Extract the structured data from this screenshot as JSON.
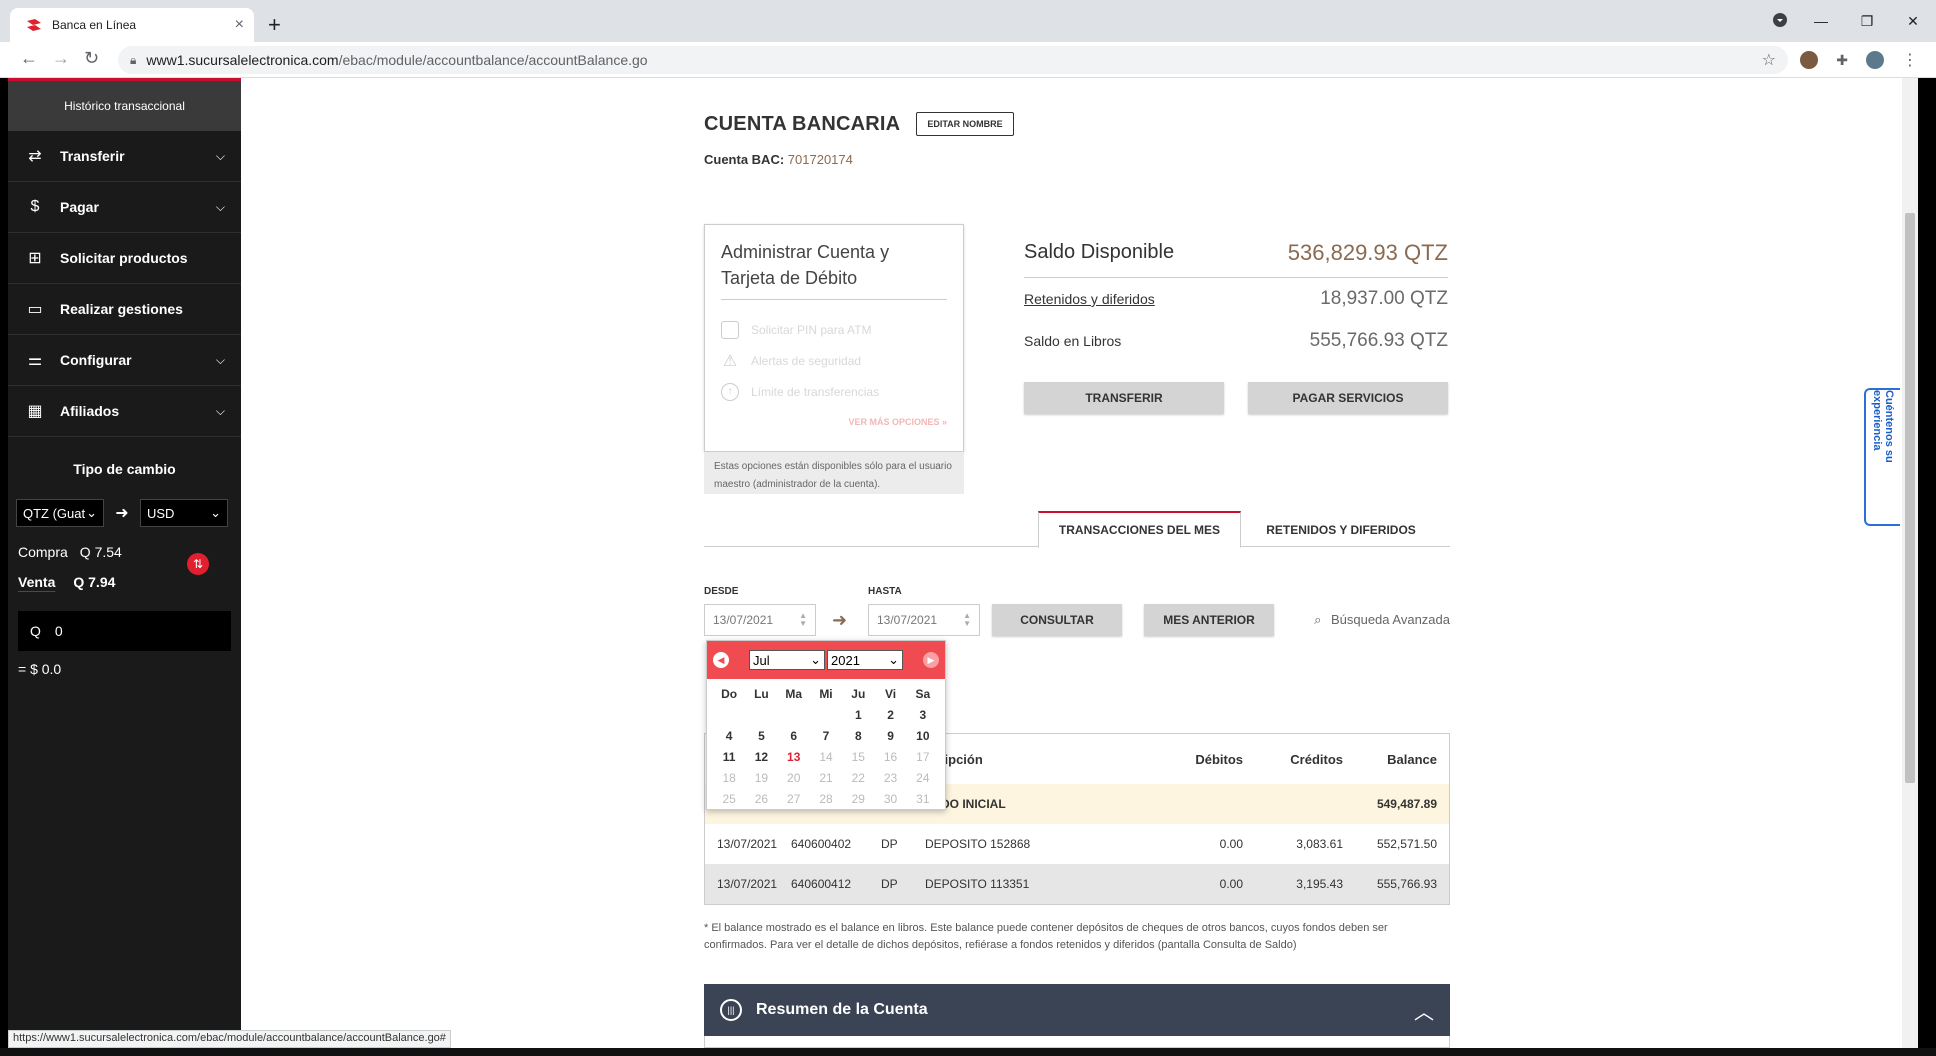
{
  "browser": {
    "tab_title": "Banca en Línea",
    "url_host": "www1.sucursalelectronica.com",
    "url_path": "/ebac/module/accountbalance/accountBalance.go",
    "status_url": "https://www1.sucursalelectronica.com/ebac/module/accountbalance/accountBalance.go#"
  },
  "sidebar": {
    "history": "Histórico transaccional",
    "items": [
      {
        "label": "Transferir",
        "icon": "transfer-icon"
      },
      {
        "label": "Pagar",
        "icon": "money-bag-icon"
      },
      {
        "label": "Solicitar productos",
        "icon": "plus-icon"
      },
      {
        "label": "Realizar gestiones",
        "icon": "id-card-icon"
      },
      {
        "label": "Configurar",
        "icon": "sliders-icon"
      },
      {
        "label": "Afiliados",
        "icon": "calculator-icon"
      }
    ],
    "fx": {
      "title": "Tipo de cambio",
      "from": "QTZ (Guat",
      "to": "USD",
      "compra_label": "Compra",
      "compra_value": "Q 7.54",
      "venta_label": "Venta",
      "venta_value": "Q 7.94",
      "input_prefix": "Q",
      "input_value": "0",
      "result": "= $ 0.0"
    }
  },
  "account": {
    "title": "CUENTA BANCARIA",
    "edit_label": "EDITAR NOMBRE",
    "bac_label": "Cuenta BAC:",
    "bac_number": "701720174"
  },
  "admin": {
    "title": "Administrar Cuenta y Tarjeta de Débito",
    "options": [
      "Solicitar PIN para ATM",
      "Alertas de seguridad",
      "Límite de transferencias"
    ],
    "more": "VER MÁS OPCIONES »",
    "note": "Estas opciones están disponibles sólo para el usuario maestro (administrador de la cuenta)."
  },
  "balances": {
    "available_label": "Saldo Disponible",
    "available_value": "536,829.93 QTZ",
    "held_label": "Retenidos y diferidos",
    "held_value": "18,937.00 QTZ",
    "book_label": "Saldo en Libros",
    "book_value": "555,766.93 QTZ",
    "transfer_btn": "TRANSFERIR",
    "pay_btn": "PAGAR SERVICIOS"
  },
  "tabs": {
    "active": "TRANSACCIONES DEL MES",
    "other": "RETENIDOS Y DIFERIDOS"
  },
  "filters": {
    "from_label": "DESDE",
    "from_value": "13/07/2021",
    "to_label": "HASTA",
    "to_value": "13/07/2021",
    "query_btn": "CONSULTAR",
    "prev_btn": "MES ANTERIOR",
    "advanced": "Búsqueda Avanzada"
  },
  "datepicker": {
    "month": "Jul",
    "year": "2021",
    "days_header": [
      "Do",
      "Lu",
      "Ma",
      "Mi",
      "Ju",
      "Vi",
      "Sa"
    ],
    "leading_blanks": 4,
    "today": 13,
    "last_enabled": 13,
    "days_in_month": 31
  },
  "table": {
    "headers": {
      "desc": "scripción",
      "debits": "Débitos",
      "credits": "Créditos",
      "balance": "Balance"
    },
    "initial": {
      "desc": "ALDO INICIAL",
      "balance": "549,487.89"
    },
    "rows": [
      {
        "date": "13/07/2021",
        "ref": "640600402",
        "type": "DP",
        "desc": "DEPOSITO 152868",
        "debit": "0.00",
        "credit": "3,083.61",
        "balance": "552,571.50"
      },
      {
        "date": "13/07/2021",
        "ref": "640600412",
        "type": "DP",
        "desc": "DEPOSITO 113351",
        "debit": "0.00",
        "credit": "3,195.43",
        "balance": "555,766.93"
      }
    ]
  },
  "footnote": "* El balance mostrado es el balance en libros. Este balance puede contener depósitos de cheques de otros bancos, cuyos fondos deben ser confirmados. Para ver el detalle de dichos depósitos, refiérase a fondos retenidos y diferidos (pantalla Consulta de Saldo)",
  "summary": {
    "title": "Resumen de la Cuenta"
  },
  "feedback": "Cuéntenos su experiencia",
  "colors": {
    "brand_red": "#c8102e",
    "picker_red": "#f04b50",
    "amount_brown": "#8a6a50",
    "summary_bar": "#3b4454"
  }
}
